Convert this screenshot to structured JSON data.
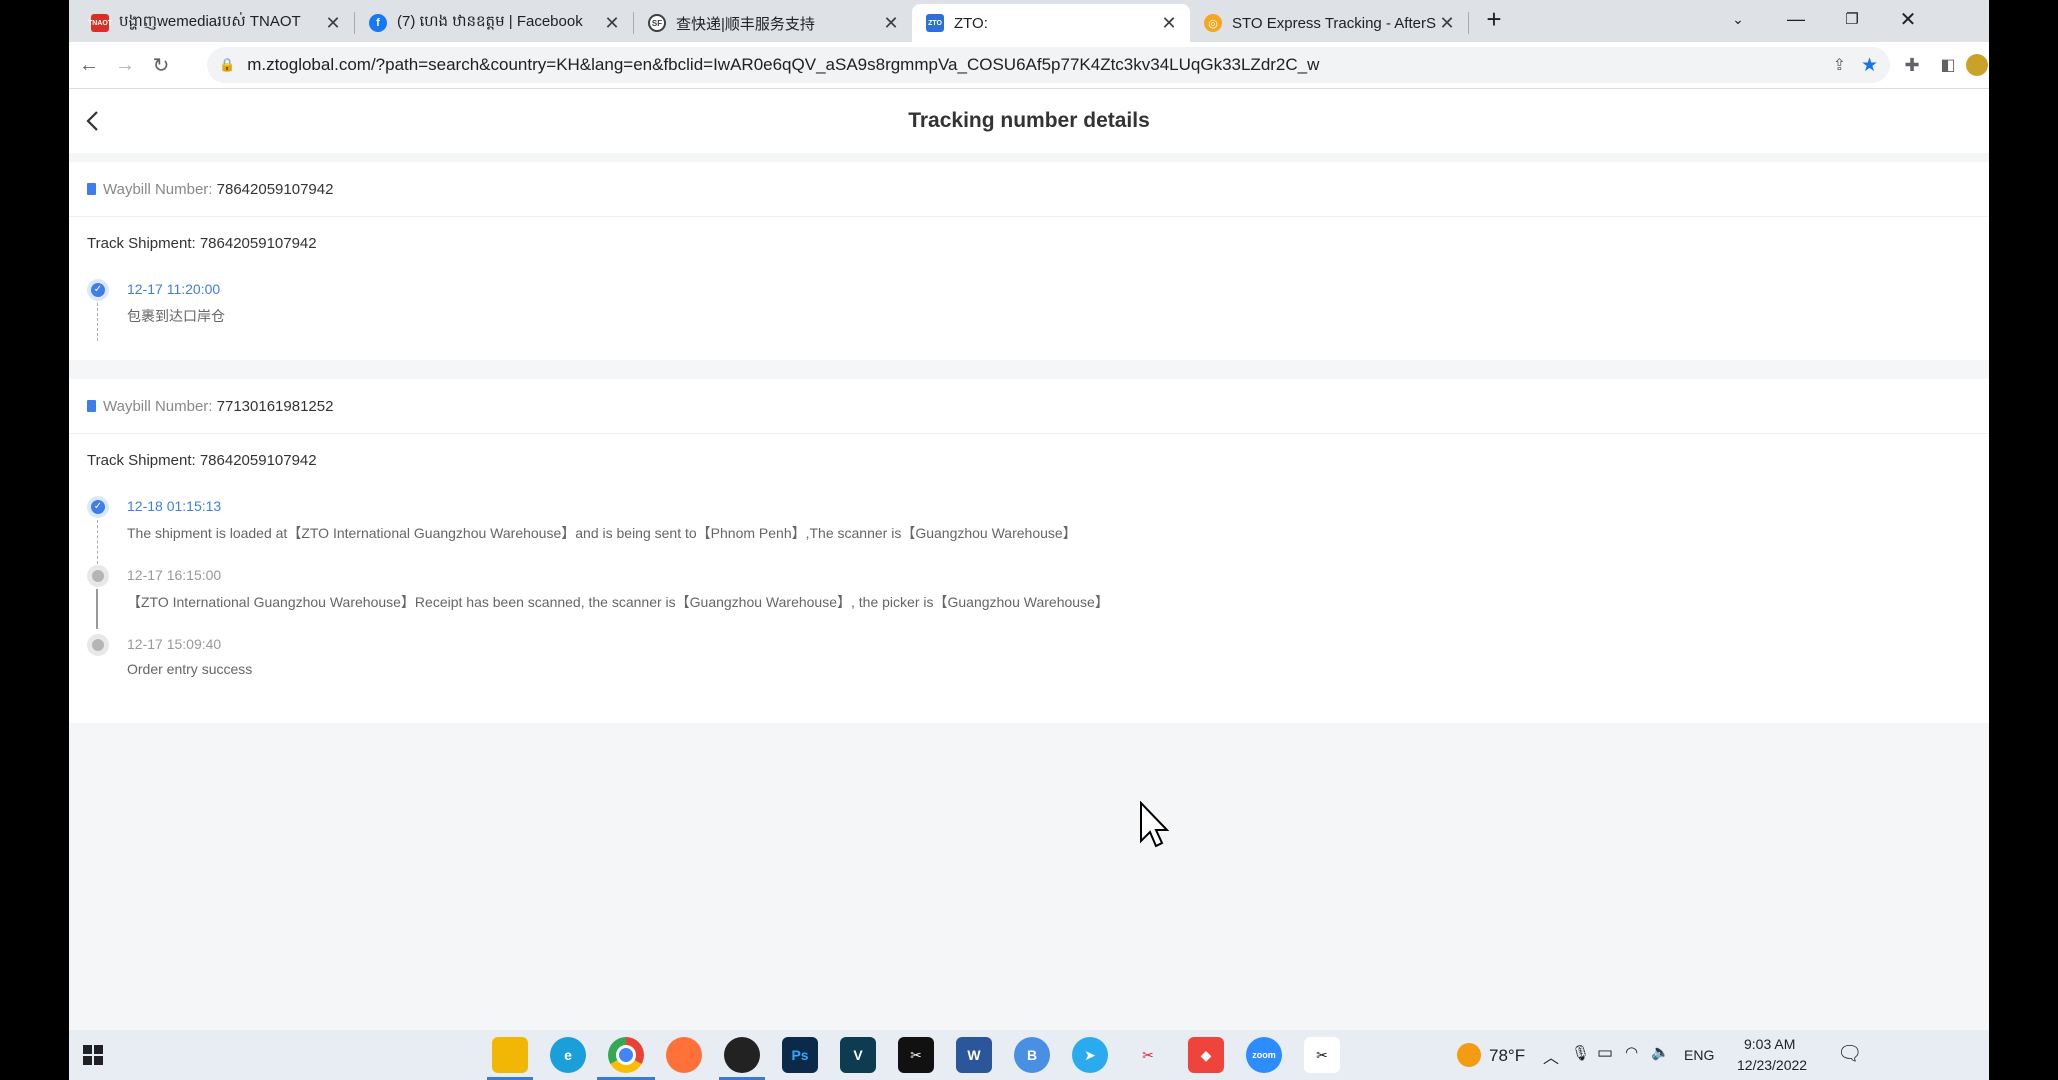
{
  "browser": {
    "tabs": [
      {
        "label": "បង្ហាញwemediaរបស់ TNAOT",
        "icon": "tnaot-icon",
        "color": "#d93025",
        "active": false
      },
      {
        "label": "(7) ហេង ឋានឧត្តម | Facebook",
        "icon": "facebook-icon",
        "color": "#1877f2",
        "active": false
      },
      {
        "label": "查快递|顺丰服务支持",
        "icon": "sf-express-icon",
        "color": "#3c4043",
        "active": false
      },
      {
        "label": "ZTO:",
        "icon": "zto-icon",
        "color": "#2f6fd8",
        "active": true
      },
      {
        "label": "STO Express Tracking - AfterShip",
        "icon": "aftership-icon",
        "color": "#f5a623",
        "active": false
      }
    ],
    "url": "m.ztoglobal.com/?path=search&country=KH&lang=en&fbclid=IwAR0e6qQV_aSA9s8rgmmpVa_COSU6Af5p77K4Ztc3kv34LUqGk33LZdr2C_w"
  },
  "page": {
    "title": "Tracking number details",
    "waybill_label": "Waybill Number:",
    "track_label": "Track Shipment:",
    "shipments": [
      {
        "waybill": "78642059107942",
        "track": "78642059107942",
        "events": [
          {
            "time": "12-17 11:20:00",
            "desc": "包裹到达口岸仓",
            "status": "done"
          }
        ]
      },
      {
        "waybill": "77130161981252",
        "track": "78642059107942",
        "events": [
          {
            "time": "12-18 01:15:13",
            "desc": "The shipment is loaded at【ZTO International Guangzhou Warehouse】and is being sent to【Phnom Penh】,The scanner is【Guangzhou Warehouse】",
            "status": "done"
          },
          {
            "time": "12-17 16:15:00",
            "desc": "【ZTO International Guangzhou Warehouse】Receipt has been scanned, the scanner is【Guangzhou Warehouse】, the picker is【Guangzhou Warehouse】",
            "status": "pending"
          },
          {
            "time": "12-17 15:09:40",
            "desc": "Order entry success",
            "status": "pending"
          }
        ]
      }
    ]
  },
  "taskbar": {
    "weather": "78°F",
    "language": "ENG",
    "time": "9:03 AM",
    "date": "12/23/2022"
  },
  "colors": {
    "accent": "#3f7ee8",
    "page_bg": "#f5f6f8"
  }
}
